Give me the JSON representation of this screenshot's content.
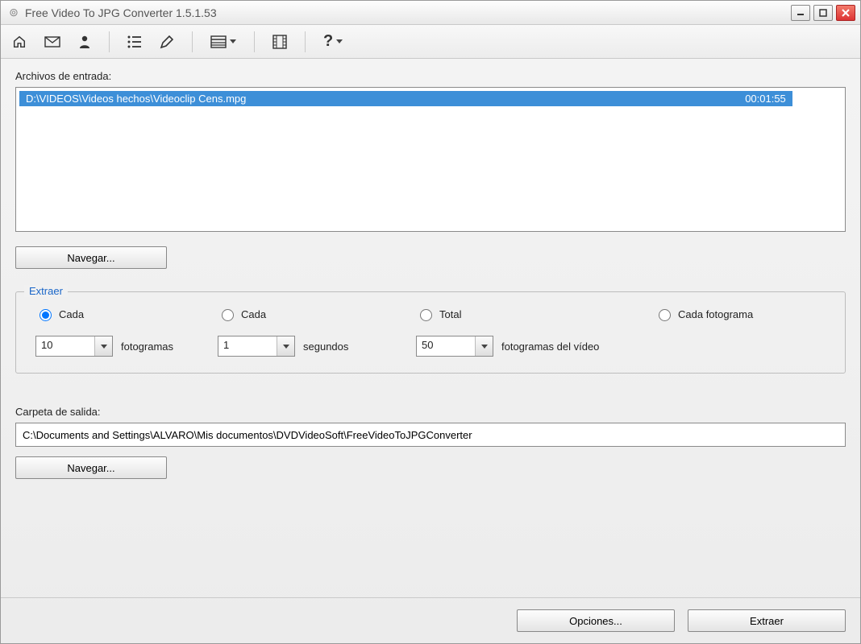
{
  "window": {
    "title": "Free Video To JPG Converter 1.5.1.53"
  },
  "input_files": {
    "label": "Archivos de entrada:",
    "rows": [
      {
        "path": "D:\\VIDEOS\\Videos hechos\\Videoclip Cens.mpg",
        "duration": "00:01:55"
      }
    ],
    "browse": "Navegar..."
  },
  "extract": {
    "legend": "Extraer",
    "options": {
      "every_frames": {
        "label": "Cada",
        "value": "10",
        "unit": "fotogramas",
        "selected": true
      },
      "every_seconds": {
        "label": "Cada",
        "value": "1",
        "unit": "segundos",
        "selected": false
      },
      "total": {
        "label": "Total",
        "value": "50",
        "unit": "fotogramas del vídeo",
        "selected": false
      },
      "every_frame": {
        "label": "Cada fotograma",
        "selected": false
      }
    }
  },
  "output": {
    "label": "Carpeta de salida:",
    "path": "C:\\Documents and Settings\\ALVARO\\Mis documentos\\DVDVideoSoft\\FreeVideoToJPGConverter",
    "browse": "Navegar..."
  },
  "footer": {
    "options": "Opciones...",
    "extract": "Extraer"
  }
}
